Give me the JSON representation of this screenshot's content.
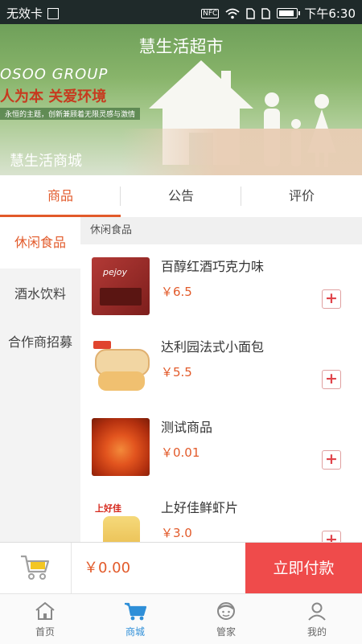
{
  "status_bar": {
    "carrier": "无效卡",
    "nfc": "NFC",
    "time": "下午6:30"
  },
  "banner": {
    "store_title": "慧生活超市",
    "group_text": "OSOO GROUP",
    "slogan": "人为本 关爱环境",
    "subtext": "永恒的主题，创新兼顾着无限灵感与激情",
    "shop_name": "慧生活商城"
  },
  "tabs": [
    {
      "label": "商品"
    },
    {
      "label": "公告"
    },
    {
      "label": "评价"
    }
  ],
  "categories": [
    {
      "label": "休闲食品"
    },
    {
      "label": "酒水饮料"
    },
    {
      "label": "合作商招募"
    }
  ],
  "section_header": "休闲食品",
  "products": [
    {
      "name": "百醇红酒巧克力味",
      "price": "￥6.5",
      "thumb_text": "pejoy"
    },
    {
      "name": "达利园法式小面包",
      "price": "￥5.5",
      "thumb_text": ""
    },
    {
      "name": "测试商品",
      "price": "￥0.01",
      "thumb_text": ""
    },
    {
      "name": "上好佳鲜虾片",
      "price": "￥3.0",
      "thumb_text": "上好佳"
    }
  ],
  "add_symbol": "+",
  "cart": {
    "total": "￥0.00",
    "pay_label": "立即付款"
  },
  "bottom_nav": [
    {
      "label": "首页",
      "icon": "home-icon"
    },
    {
      "label": "商城",
      "icon": "cart-icon"
    },
    {
      "label": "管家",
      "icon": "butler-icon"
    },
    {
      "label": "我的",
      "icon": "user-icon"
    }
  ],
  "colors": {
    "accent": "#e25a2a",
    "pay_button": "#ef4b4b",
    "nav_active": "#2f8fd8",
    "status_bar": "#1f2a2a"
  }
}
